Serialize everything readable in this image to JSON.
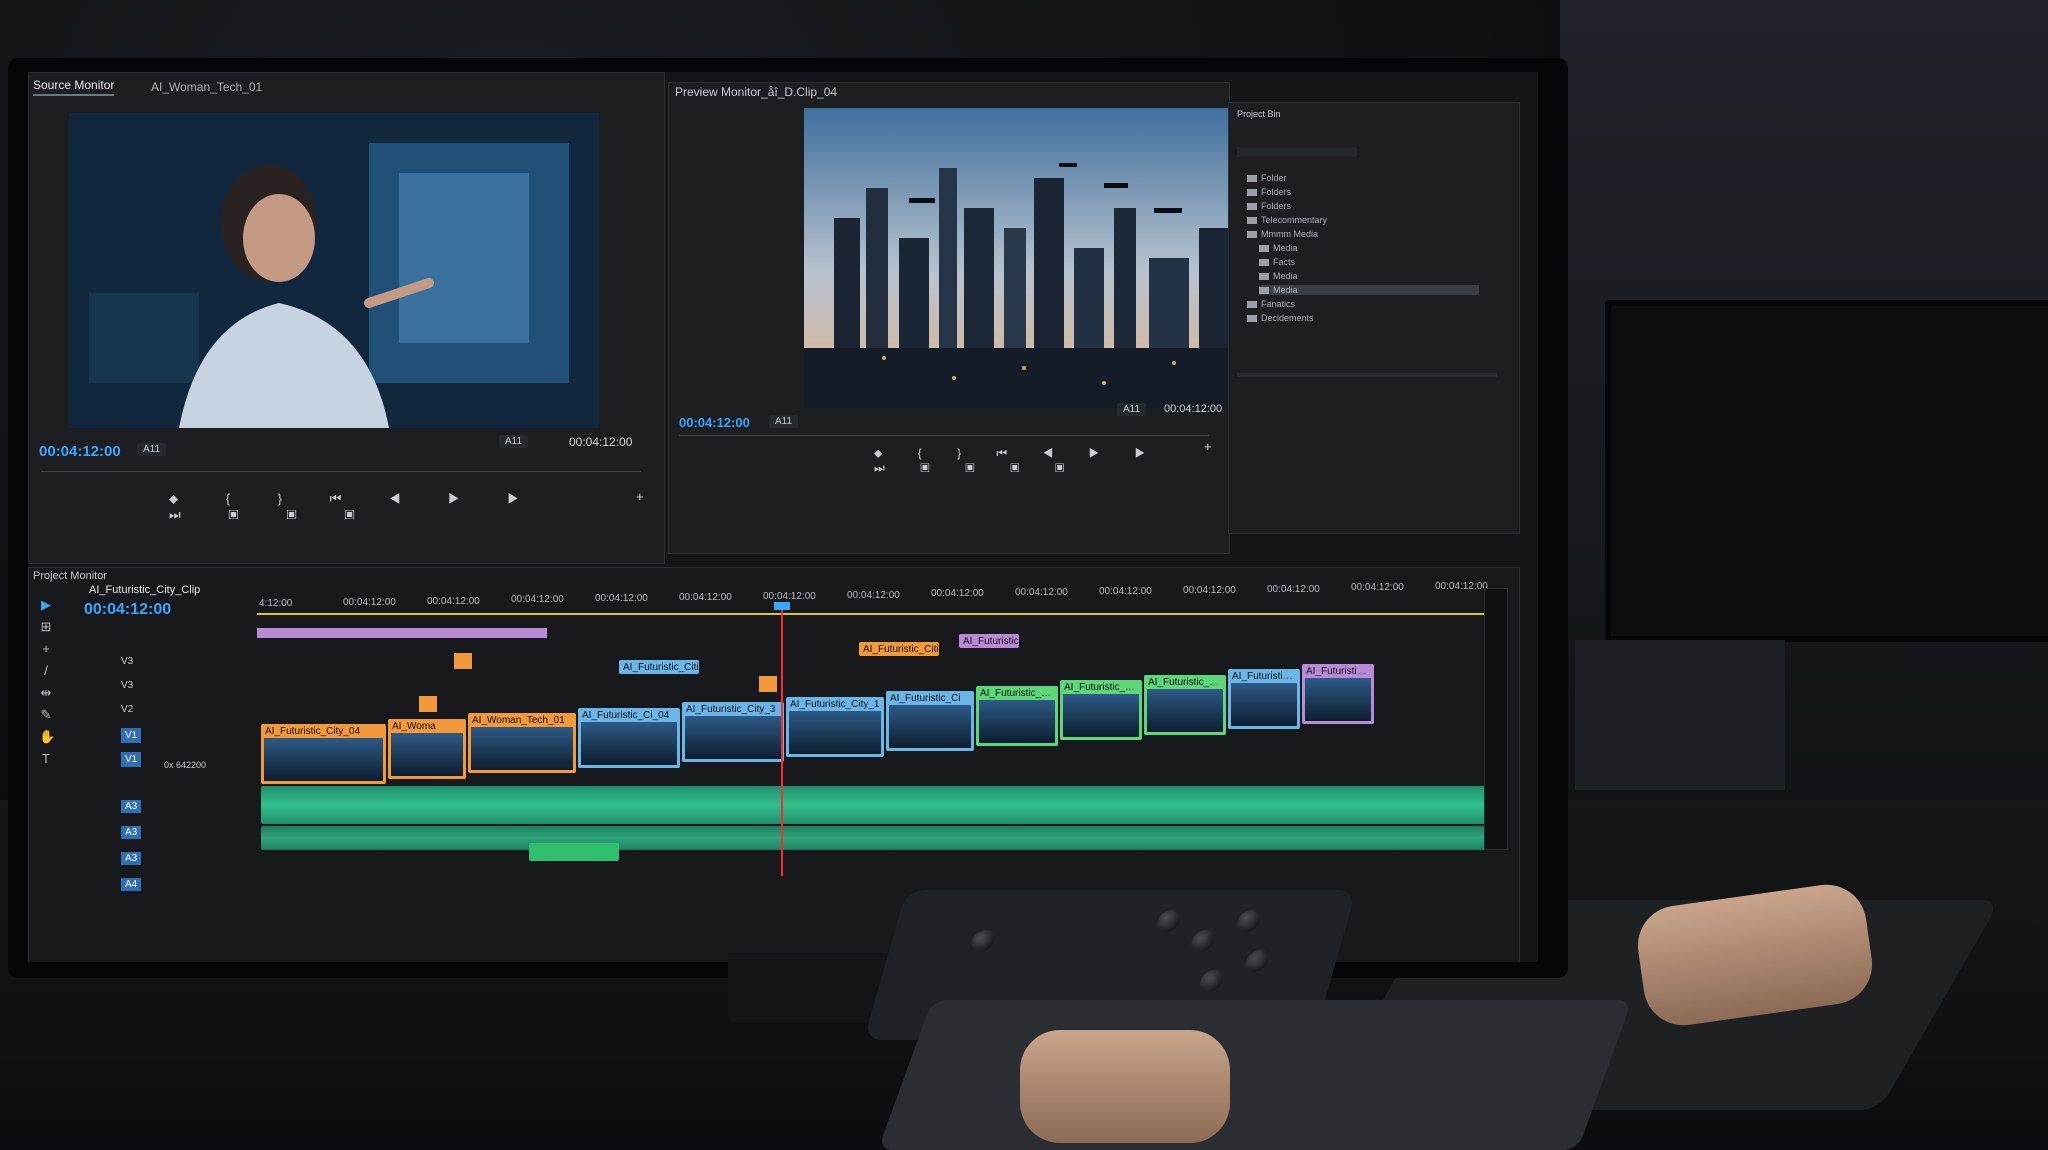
{
  "source_monitor": {
    "tab_active": "Source Monitor",
    "tab_clip": "AI_Woman_Tech_01",
    "timecode": "00:04:12:00",
    "fit": "A11",
    "fit_right": "A11",
    "timecode_right": "00:04:12:00"
  },
  "preview_monitor": {
    "title": "Preview Monitor_åî_D.Clip_04",
    "timecode": "00:04:12:00",
    "fit": "A11",
    "fit_right": "A11",
    "timecode_right": "00:04:12:00"
  },
  "project_bin": {
    "title": "Project Bin",
    "items": [
      "Folder",
      "Folders",
      "Folders",
      "Telecommentary",
      "Mmmm Media",
      "Media",
      "Facts",
      "Media",
      "Media",
      "Fanatics",
      "Decidements"
    ]
  },
  "project_monitor": {
    "title": "Project Monitor"
  },
  "timeline": {
    "sequence_name": "AI_Futuristic_City_Clip",
    "timecode": "00:04:12:00",
    "ruler_ticks": [
      "4:12:00",
      "00:04:12:00",
      "00:04:12:00",
      "00:04:12:00",
      "00:04:12:00",
      "00:04:12:00",
      "00:04:12:00",
      "00:04:12:00",
      "00:04:12:00",
      "00:04:12:00",
      "00:04:12:00",
      "00:04:12:00",
      "00:04:12:00",
      "00:04:12:00",
      "00:04:12:00"
    ],
    "video_tracks": [
      "V3",
      "V3",
      "V2",
      "V1",
      "V1"
    ],
    "audio_tracks": [
      "A3",
      "A3",
      "A3",
      "A4"
    ],
    "v1_meta": "0x 642200",
    "v3_clips": [
      "AI_Futuristic_Cities",
      "AI_Futuristic_Cities",
      "AI_Futuristic_AI"
    ],
    "v1_clips": [
      "AI_Futuristic_City_04",
      "AI_Woma",
      "AI_Woman_Tech_01",
      "AI_Futuristic_Ci_04",
      "AI_Futuristic_City_3",
      "AI_Futuristic_City_1",
      "AI_Futuristic_Ci",
      "AI_Futuristic_Clip",
      "AI_Futuristic_Clip",
      "AI_Futuristic_Clip",
      "AI_Futuristic_Clip",
      "AI_Futuristic_Clip"
    ]
  },
  "colors": {
    "accent": "#3aa7ff",
    "clip_orange": "#f29a3a",
    "clip_blue": "#6bb6e8",
    "clip_green": "#5ed67a",
    "clip_purple": "#b98bd6",
    "audio_green": "#33c08f",
    "playhead": "#ff2b2b"
  }
}
